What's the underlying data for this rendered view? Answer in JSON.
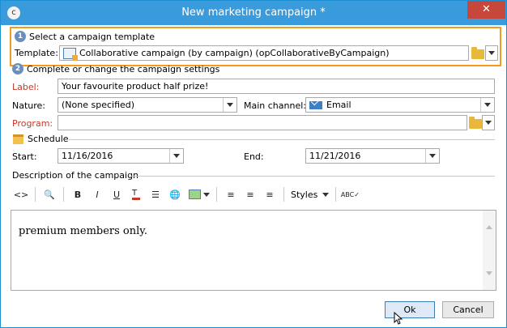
{
  "window": {
    "title": "New marketing campaign *",
    "close_label": "✕",
    "app_icon": "c"
  },
  "step1": {
    "number": "1",
    "label": "Select a campaign template"
  },
  "template": {
    "label": "Template:",
    "value": "Collaborative campaign (by campaign) (opCollaborativeByCampaign)"
  },
  "step2": {
    "number": "2",
    "label": "Complete or change the campaign settings"
  },
  "form": {
    "label_label": "Label:",
    "label_value": "Your favourite product half prize!",
    "nature_label": "Nature:",
    "nature_value": "(None specified)",
    "channel_label": "Main channel:",
    "channel_value": "Email",
    "program_label": "Program:",
    "program_value": ""
  },
  "schedule": {
    "title": "Schedule",
    "start_label": "Start:",
    "start_value": "11/16/2016",
    "end_label": "End:",
    "end_value": "11/21/2016"
  },
  "description": {
    "title": "Description of the campaign",
    "text": "premium members only."
  },
  "toolbar": {
    "bold": "B",
    "italic": "I",
    "underline": "U",
    "styles_label": "Styles"
  },
  "buttons": {
    "ok": "Ok",
    "cancel": "Cancel"
  },
  "colors": {
    "titlebar": "#3a9bdc",
    "highlight": "#f59b1b",
    "close": "#c7473a",
    "required": "#c0392b"
  }
}
